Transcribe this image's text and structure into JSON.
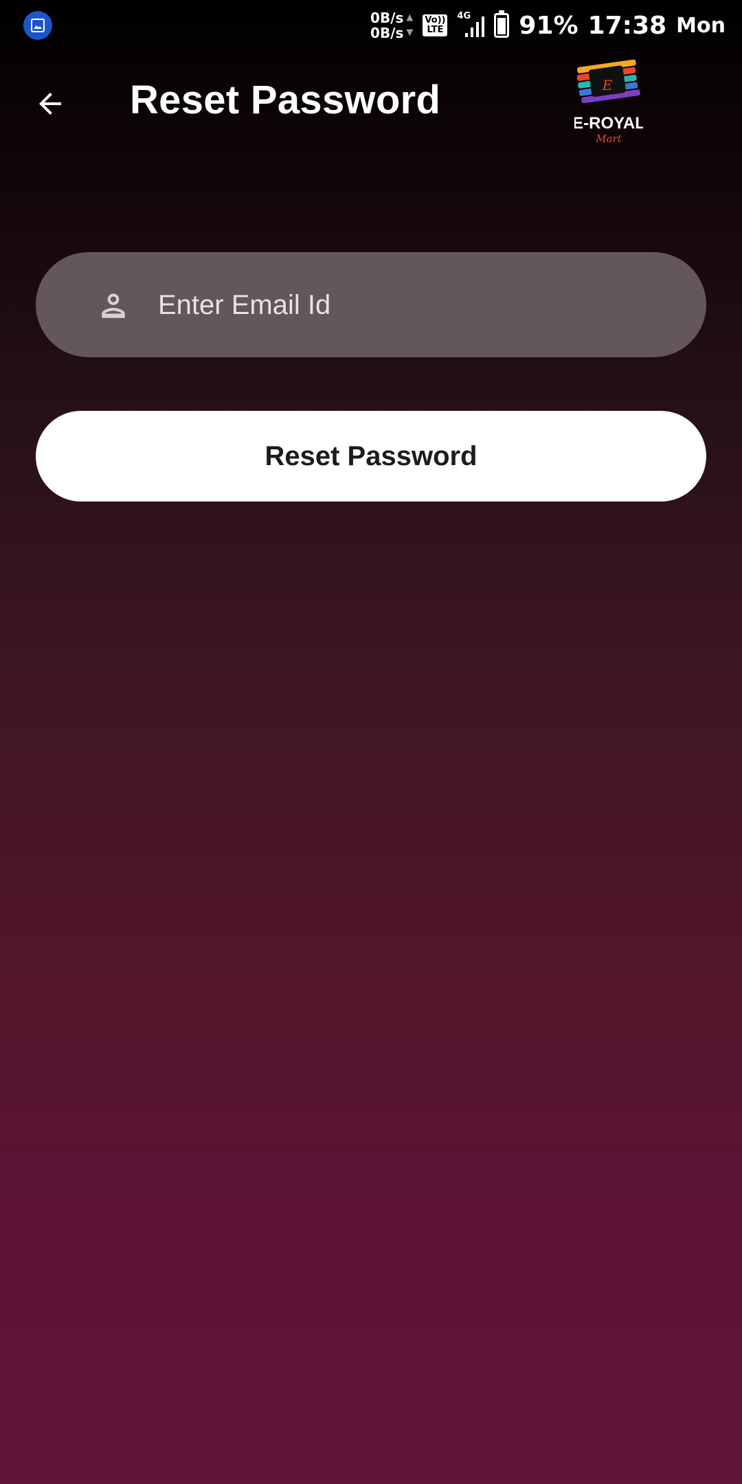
{
  "status_bar": {
    "upload_speed": "0B/s",
    "download_speed": "0B/s",
    "volte_line1": "Vo))",
    "volte_line2": "LTE",
    "network_type": "4G",
    "battery_percent": "91%",
    "time": "17:38",
    "day": "Mon",
    "notification_icon": "gallery-icon"
  },
  "app_bar": {
    "back_icon": "arrow-left-icon",
    "title": "Reset Password",
    "logo_text": "E-ROYAL",
    "logo_subtext": "Mart",
    "logo_letter": "E"
  },
  "form": {
    "email_icon": "person-icon",
    "email_placeholder": "Enter Email Id",
    "email_value": "",
    "submit_label": "Reset Password"
  },
  "colors": {
    "field_background": "#63575a",
    "button_background": "#ffffff",
    "gradient_bottom": "#63143b"
  }
}
